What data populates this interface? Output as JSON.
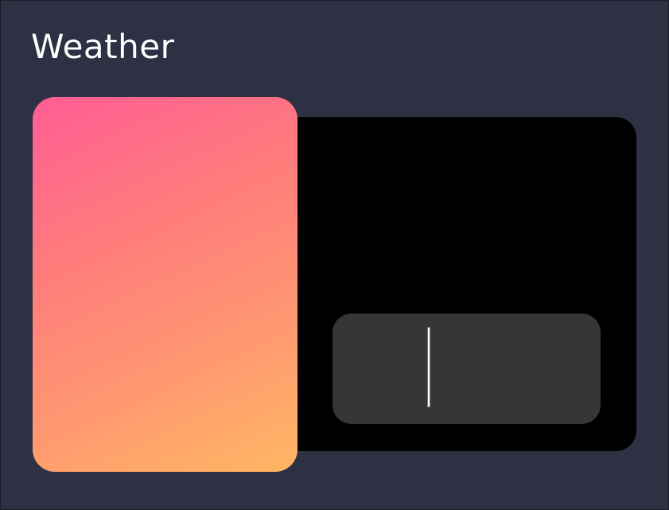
{
  "header": {
    "title": "Weather"
  },
  "colors": {
    "background": "#2e3043",
    "panel": "#000000",
    "input_box": "#363636",
    "card_gradient_start": "#ff5d94",
    "card_gradient_end": "#ffb763"
  },
  "input": {
    "value": ""
  }
}
